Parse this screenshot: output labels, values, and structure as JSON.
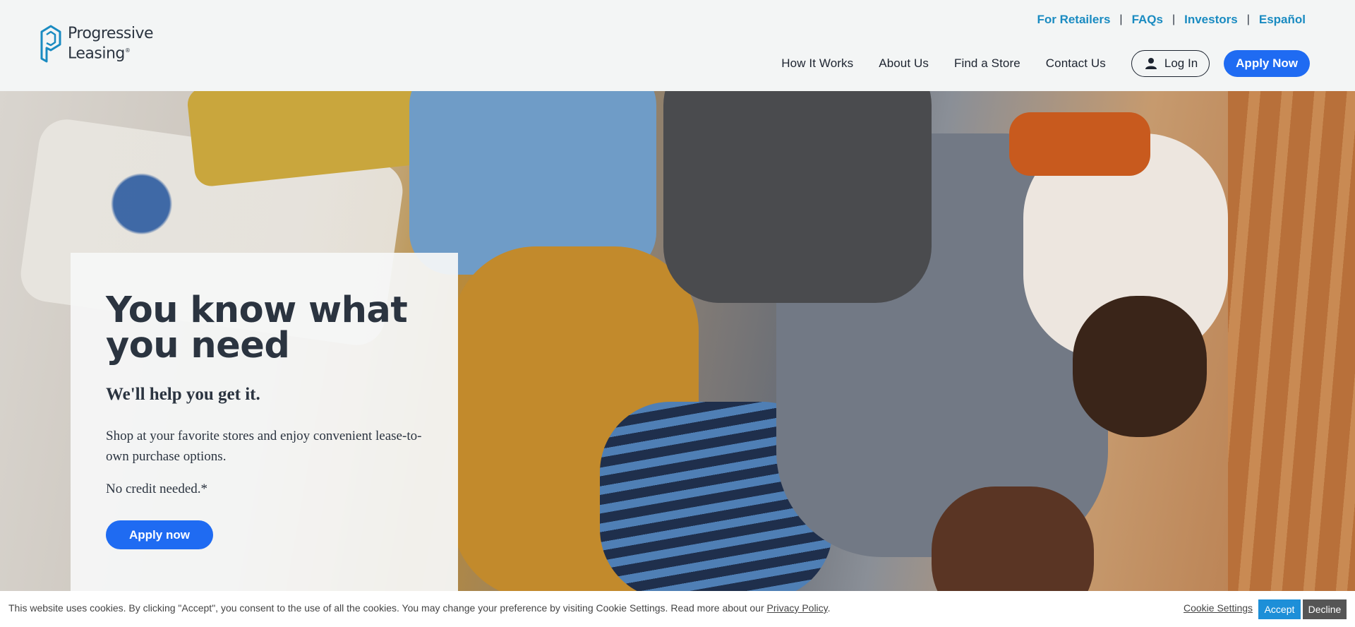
{
  "brand": {
    "logo_line1": "Progressive",
    "logo_line2": "Leasing",
    "logo_icon": "progressive-p-icon",
    "accent_color": "#1f6bf2",
    "link_color": "#1a8bc1"
  },
  "utility_nav": {
    "items": [
      "For Retailers",
      "FAQs",
      "Investors",
      "Español"
    ]
  },
  "main_nav": {
    "items": [
      "How It Works",
      "About Us",
      "Find a Store",
      "Contact Us"
    ],
    "login_label": "Log In",
    "login_icon": "user-icon",
    "apply_label": "Apply Now"
  },
  "hero": {
    "headline": "You know what you need",
    "subhead": "We'll help you get it.",
    "body": "Shop at your favorite stores and enjoy convenient lease-to-own purchase options.",
    "no_credit": "No credit needed.*",
    "cta_label": "Apply now"
  },
  "cookie_bar": {
    "text": "This website uses cookies. By clicking \"Accept\", you consent to the use of all the cookies. You may change your preference by visiting Cookie Settings. Read more about our ",
    "privacy_link": "Privacy Policy",
    "period": ".",
    "settings_label": "Cookie Settings",
    "accept_label": "Accept",
    "decline_label": "Decline"
  }
}
